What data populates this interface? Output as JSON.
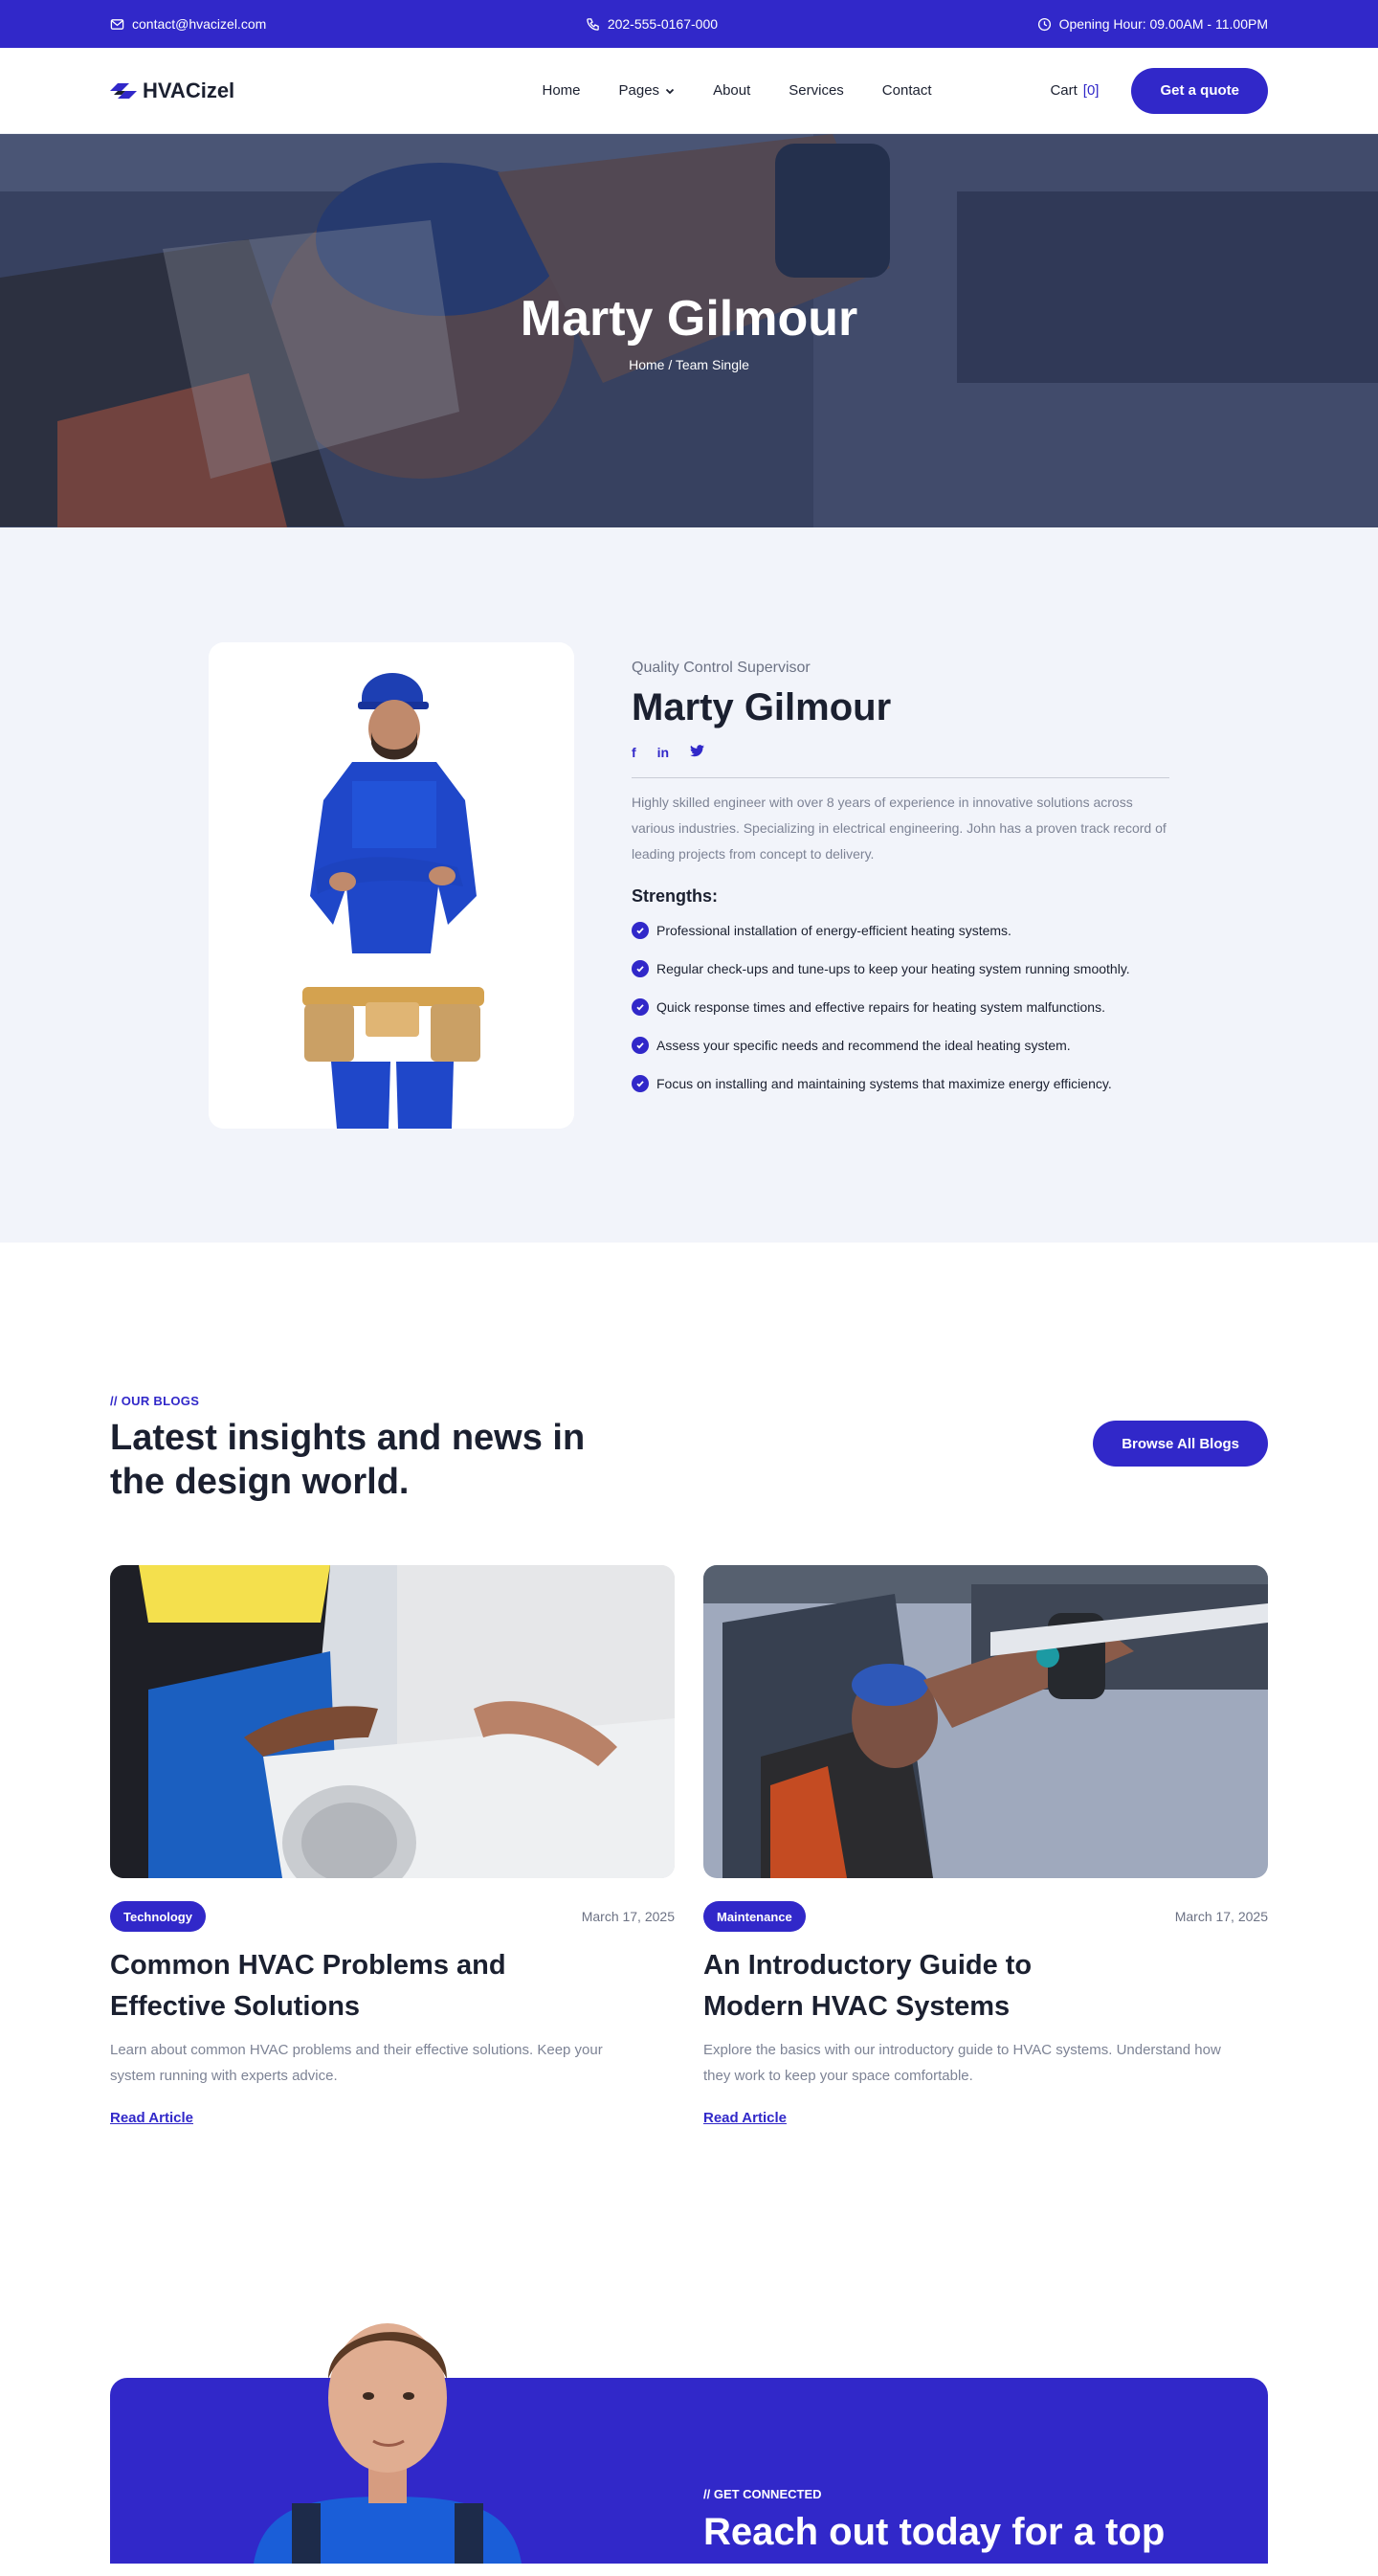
{
  "topbar": {
    "email": "contact@hvacizel.com",
    "phone": "202-555-0167-000",
    "hours": "Opening Hour: 09.00AM - 11.00PM"
  },
  "header": {
    "brand": "HVACizel",
    "nav": [
      "Home",
      "Pages",
      "About",
      "Services",
      "Contact"
    ],
    "cart_label": "Cart",
    "cart_count": "[0]",
    "quote_button": "Get a quote"
  },
  "hero": {
    "title": "Marty Gilmour",
    "breadcrumb": "Home / Team Single"
  },
  "profile": {
    "role": "Quality Control Supervisor",
    "name": "Marty Gilmour",
    "socials": [
      "facebook-icon",
      "linkedin-icon",
      "twitter-icon"
    ],
    "bio": "Highly skilled  engineer with over 8 years of experience in  innovative solutions across various industries. Specializing in electrical engineering. John has a proven track record of leading projects from concept to delivery.",
    "strengths_title": "Strengths:",
    "strengths": [
      "Professional installation of energy-efficient heating systems.",
      "Regular check-ups and tune-ups to keep your heating system running smoothly.",
      "Quick response times and effective repairs for heating system malfunctions.",
      "Assess your specific needs and recommend the ideal heating system.",
      "Focus on installing and maintaining systems that maximize energy efficiency."
    ]
  },
  "blogs": {
    "eyebrow": "// OUR BLOGS",
    "title": "Latest insights and news in the design world.",
    "browse_button": "Browse All Blogs",
    "posts": [
      {
        "tag": "Technology",
        "date": "March 17, 2025",
        "title": "Common HVAC Problems and Effective Solutions",
        "excerpt": "Learn about common HVAC problems and their effective solutions. Keep your system running with experts advice.",
        "link": "Read Article"
      },
      {
        "tag": "Maintenance",
        "date": "March 17, 2025",
        "title": "An Introductory Guide to Modern HVAC Systems",
        "excerpt": "Explore the basics with our introductory guide to HVAC systems. Understand how they work to keep your space comfortable.",
        "link": "Read Article"
      }
    ]
  },
  "cta": {
    "eyebrow": "// GET CONNECTED",
    "title": "Reach out today for a top"
  },
  "colors": {
    "primary": "#3128c9",
    "dark_text": "#1b2030",
    "muted_text": "#7d8395",
    "light_bg": "#f2f4fa"
  }
}
